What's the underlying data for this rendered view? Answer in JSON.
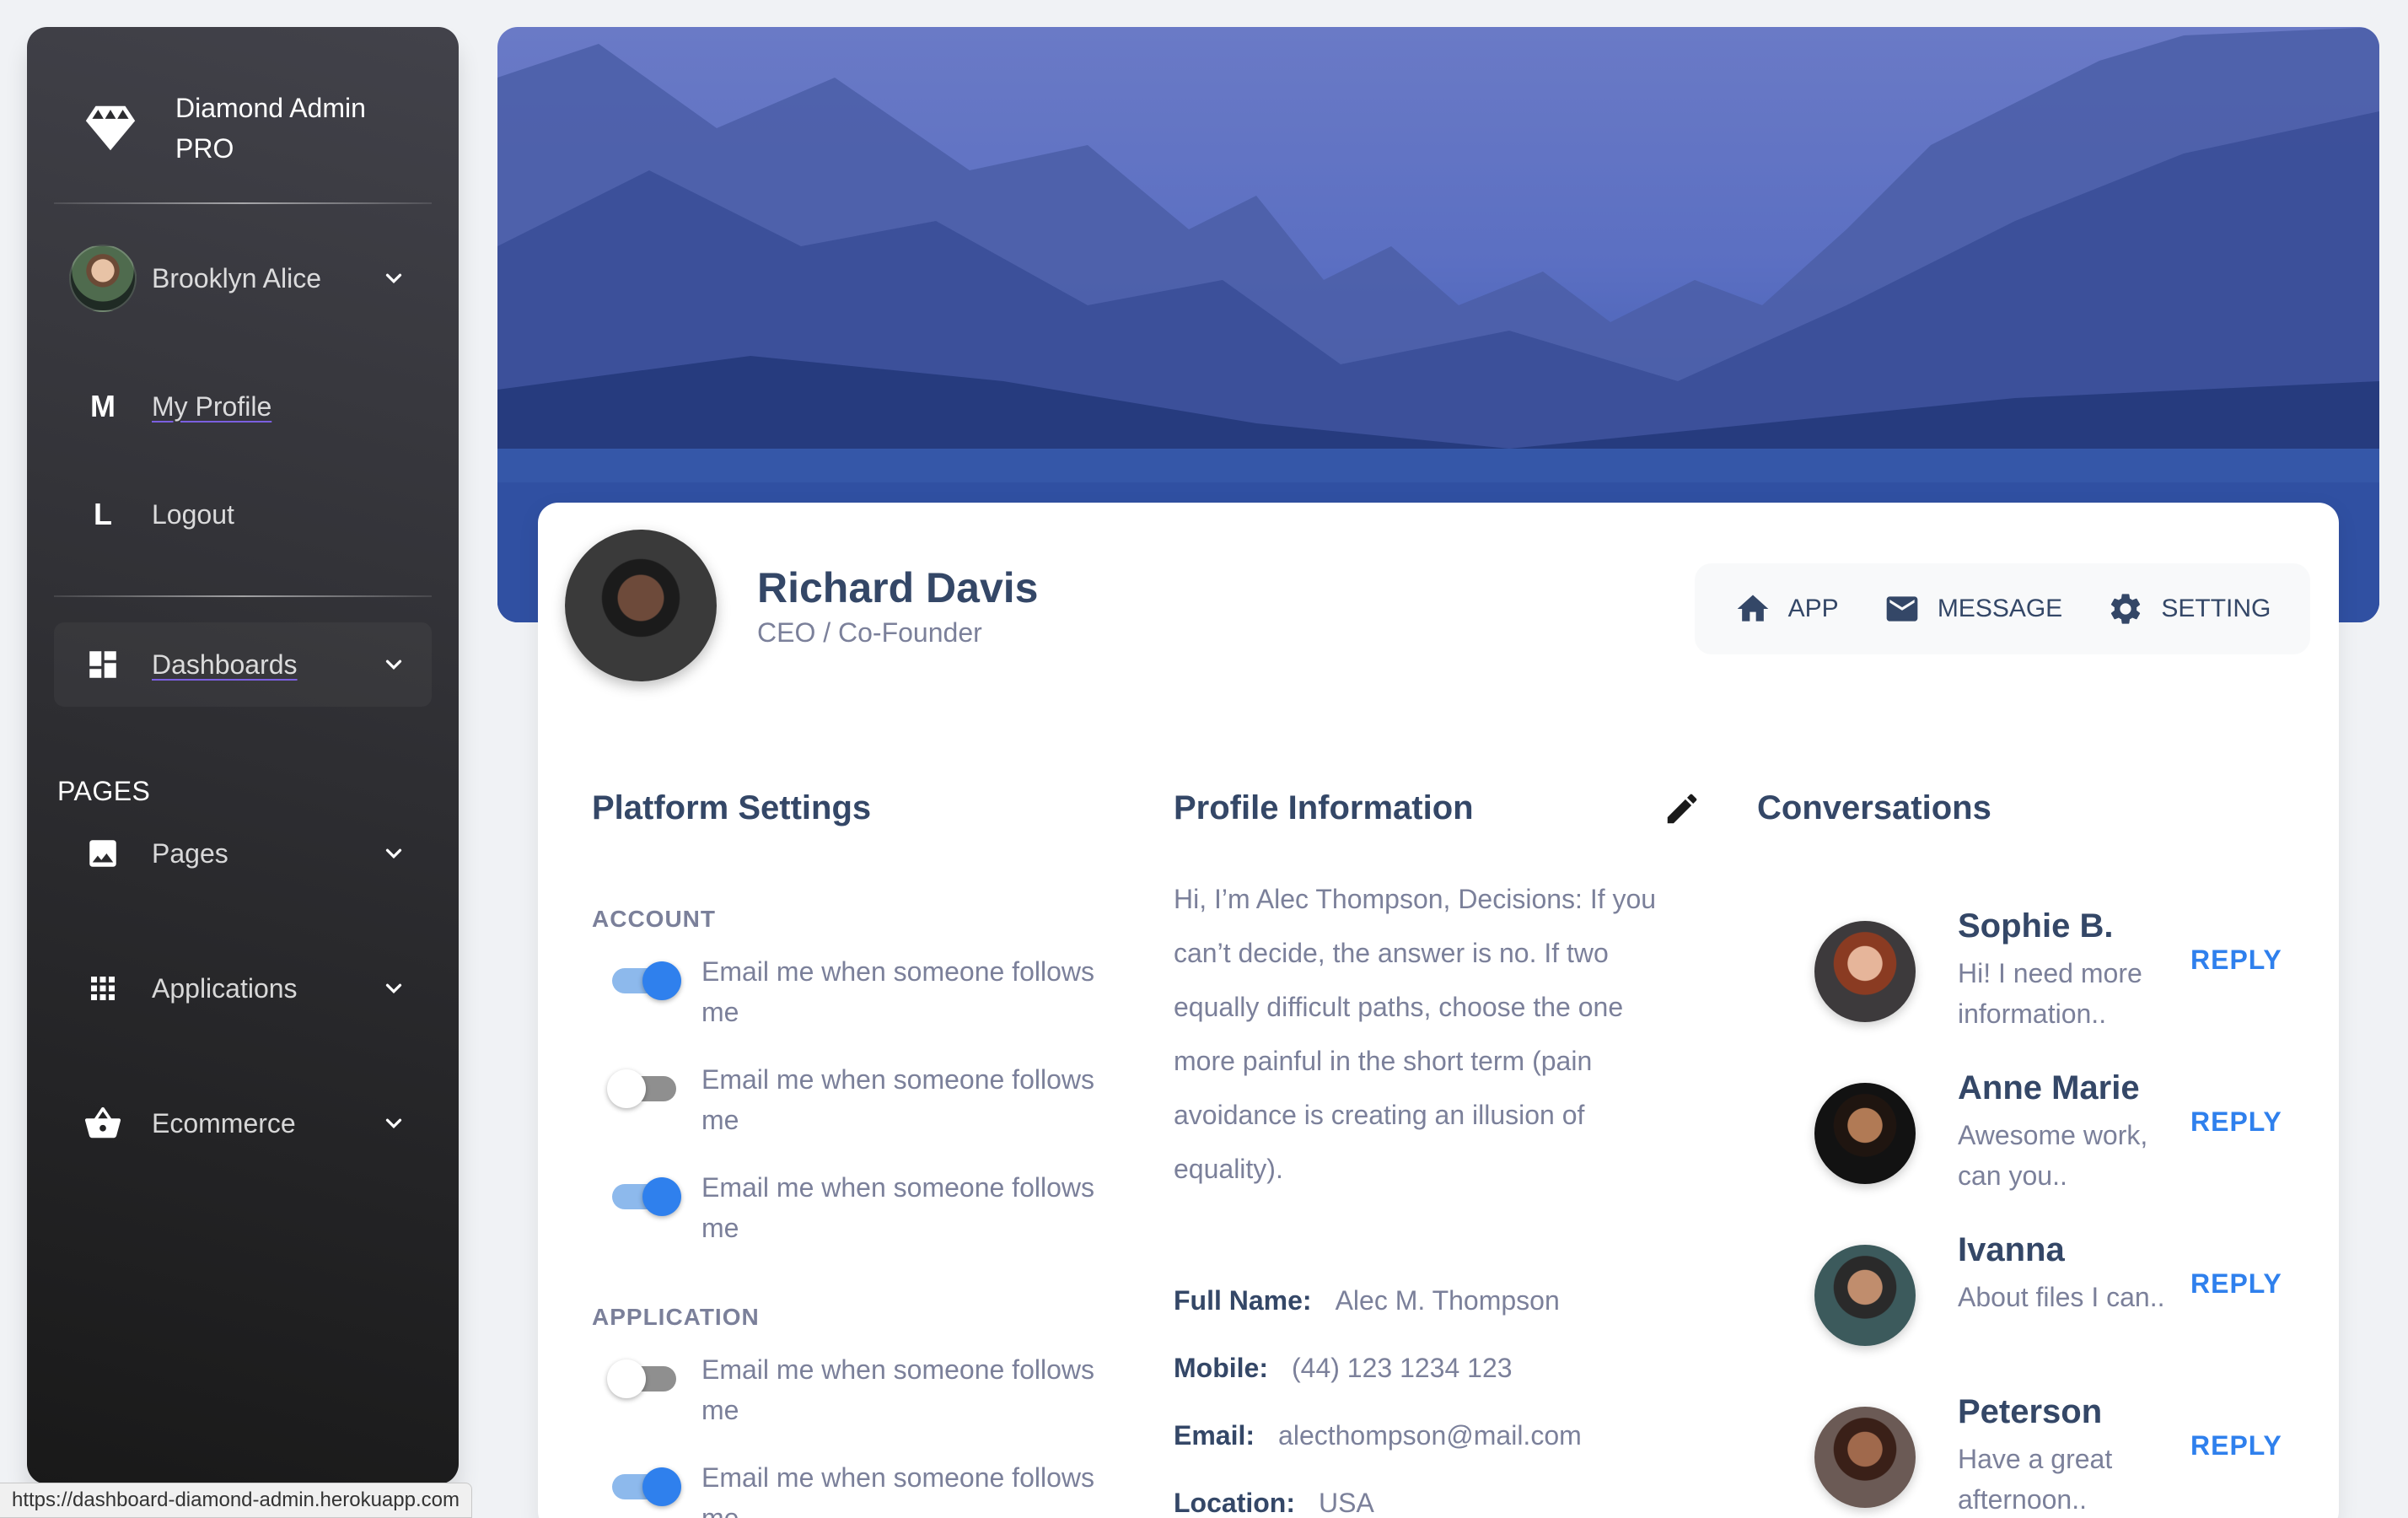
{
  "sidebar": {
    "brand": "Diamond Admin PRO",
    "user": {
      "name": "Brooklyn Alice"
    },
    "user_menu": [
      {
        "letter": "M",
        "label": "My Profile"
      },
      {
        "letter": "L",
        "label": "Logout"
      }
    ],
    "dashboards_label": "Dashboards",
    "section_title": "PAGES",
    "items": [
      {
        "label": "Pages",
        "icon": "image-icon"
      },
      {
        "label": "Applications",
        "icon": "apps-grid-icon"
      },
      {
        "label": "Ecommerce",
        "icon": "basket-icon"
      }
    ]
  },
  "profile": {
    "name": "Richard Davis",
    "role": "CEO / Co-Founder",
    "tabs": [
      {
        "label": "APP",
        "icon": "home-icon"
      },
      {
        "label": "MESSAGE",
        "icon": "email-icon"
      },
      {
        "label": "SETTING",
        "icon": "gear-icon"
      }
    ]
  },
  "platform_settings": {
    "title": "Platform Settings",
    "account_title": "ACCOUNT",
    "application_title": "APPLICATION",
    "account": [
      {
        "text": "Email me when someone follows me",
        "on": true
      },
      {
        "text": "Email me when someone follows me",
        "on": false
      },
      {
        "text": "Email me when someone follows me",
        "on": true
      }
    ],
    "application": [
      {
        "text": "Email me when someone follows me",
        "on": false
      },
      {
        "text": "Email me when someone follows me",
        "on": true
      }
    ]
  },
  "profile_info": {
    "title": "Profile Information",
    "bio": "Hi, I’m Alec Thompson, Decisions: If you can’t decide, the answer is no. If two equally difficult paths, choose the one more painful in the short term (pain avoidance is creating an illusion of equality).",
    "fields": [
      {
        "label": "Full Name:",
        "value": "Alec M. Thompson"
      },
      {
        "label": "Mobile:",
        "value": "(44) 123 1234 123"
      },
      {
        "label": "Email:",
        "value": "alecthompson@mail.com"
      },
      {
        "label": "Location:",
        "value": "USA"
      }
    ]
  },
  "conversations": {
    "title": "Conversations",
    "reply_label": "REPLY",
    "items": [
      {
        "name": "Sophie B.",
        "message": "Hi! I need more information.."
      },
      {
        "name": "Anne Marie",
        "message": "Awesome work, can you.."
      },
      {
        "name": "Ivanna",
        "message": "About files I can.."
      },
      {
        "name": "Peterson",
        "message": "Have a great afternoon.."
      }
    ]
  },
  "status_bar": {
    "url": "https://dashboard-diamond-admin.herokuapp.com"
  },
  "colors": {
    "accent": "#2f80ed",
    "heading": "#344767",
    "muted": "#7b809a",
    "sidebar_dark": "#191919"
  }
}
